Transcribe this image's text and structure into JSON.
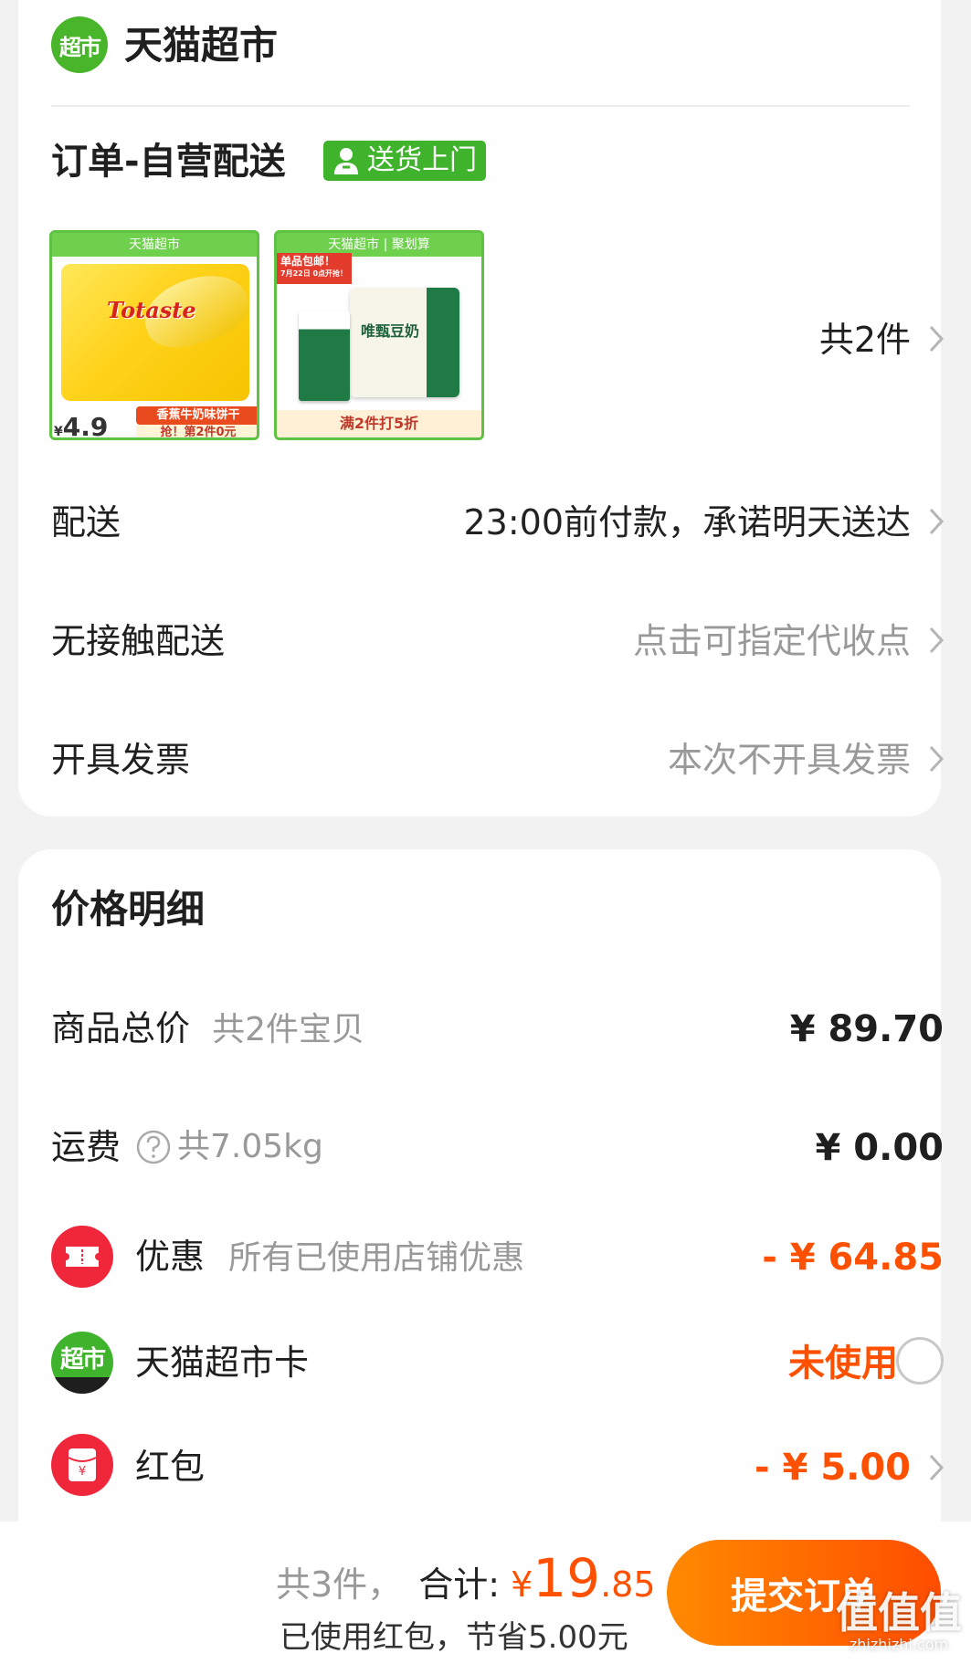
{
  "shop": {
    "logo_text": "超市",
    "name": "天猫超市"
  },
  "order": {
    "title": "订单-自营配送",
    "badge": "送货上门",
    "count_label": "共2件",
    "products": [
      {
        "header": "天猫超市",
        "brand": "Totaste",
        "tag": "香蕉牛奶味饼干",
        "price": "4.9",
        "price_symbol": "¥",
        "deal": "抢！第2件0元"
      },
      {
        "header": "天猫超市 | 聚划算",
        "label": "单品包邮！",
        "label_sub": "7月22日 0点开抢！",
        "product_name": "唯甄豆奶",
        "deal": "满2件打5折"
      }
    ]
  },
  "rows": {
    "delivery": {
      "label": "配送",
      "value": "23:00前付款，承诺明天送达"
    },
    "contactless": {
      "label": "无接触配送",
      "value": "点击可指定代收点"
    },
    "invoice": {
      "label": "开具发票",
      "value": "本次不开具发票"
    }
  },
  "price": {
    "title": "价格明细",
    "goods_total": {
      "label": "商品总价",
      "sub": "共2件宝贝",
      "value": "¥ 89.70"
    },
    "shipping": {
      "label": "运费",
      "sub": "共7.05kg",
      "value": "¥ 0.00"
    },
    "discount": {
      "label": "优惠",
      "sub": "所有已使用店铺优惠",
      "value": "- ¥ 64.85"
    },
    "market_card": {
      "icon_text": "超市",
      "label": "天猫超市卡",
      "value": "未使用"
    },
    "red_packet": {
      "label": "红包",
      "icon_text": "¥",
      "value": "- ¥ 5.00"
    }
  },
  "bottom": {
    "count": "共3件，",
    "total_label": "合计:",
    "currency": "¥",
    "total_int": "19",
    "total_dec": ".85",
    "saved": "已使用红包，节省5.00元",
    "submit": "提交订单"
  },
  "watermark": {
    "text": "值值值",
    "sub": "zhizhizhi.com"
  },
  "colors": {
    "accent": "#ff5000",
    "green": "#3fb32b",
    "red": "#f0263b"
  }
}
